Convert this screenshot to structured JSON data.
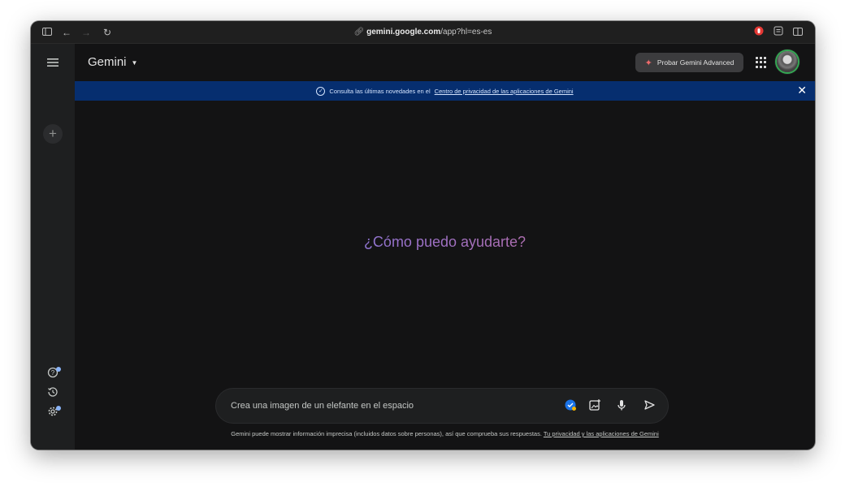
{
  "browser": {
    "url_domain": "gemini.google.com",
    "url_path": "/app?hl=es-es"
  },
  "header": {
    "brand": "Gemini",
    "advanced_button": "Probar Gemini Advanced"
  },
  "banner": {
    "text": "Consulta las últimas novedades en el",
    "link": "Centro de privacidad de las aplicaciones de Gemini"
  },
  "greeting": "¿Cómo puedo ayudarte?",
  "prompt": {
    "placeholder": "Crea una imagen de un elefante en el espacio"
  },
  "disclaimer": {
    "text": "Gemini puede mostrar información imprecisa (incluidos datos sobre personas), así que comprueba sus respuestas.",
    "link": "Tu privacidad y las aplicaciones de Gemini"
  },
  "colors": {
    "background": "#131314",
    "sidebar": "#1e1f20",
    "banner": "#062e6f",
    "greeting_gradient": [
      "#4285f4",
      "#9b72cb",
      "#d96570"
    ]
  }
}
